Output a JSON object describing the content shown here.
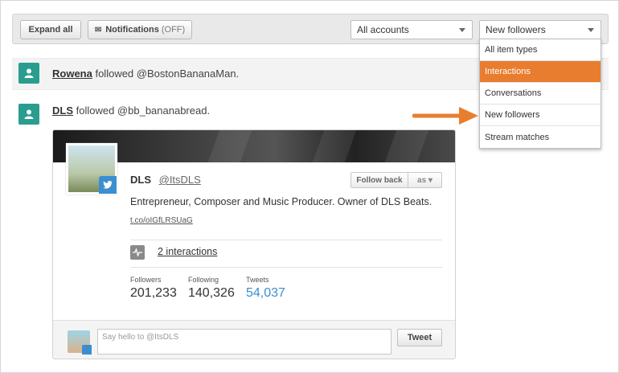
{
  "toolbar": {
    "expand_label": "Expand all",
    "notifications_label": "Notifications",
    "notifications_state": "(OFF)",
    "accounts_select": "All accounts",
    "type_select": "New followers"
  },
  "menu": {
    "items": [
      "All item types",
      "Interactions",
      "Conversations",
      "New followers",
      "Stream matches"
    ],
    "highlighted": "Interactions"
  },
  "stream": [
    {
      "user": "Rowena",
      "action": "followed @BostonBananaMan."
    },
    {
      "user": "DLS",
      "action": "followed @bb_bananabread."
    }
  ],
  "profile": {
    "name": "DLS",
    "handle": "@ItsDLS",
    "follow_back": "Follow back",
    "as_label": "as ▾",
    "bio": "Entrepreneur, Composer and Music Producer. Owner of DLS Beats.",
    "link": "t.co/oIGfLRSUaG",
    "interactions": "2 interactions",
    "stats": [
      {
        "label": "Followers",
        "value": "201,233"
      },
      {
        "label": "Following",
        "value": "140,326"
      },
      {
        "label": "Tweets",
        "value": "54,037"
      }
    ]
  },
  "reply": {
    "placeholder": "Say hello to @ItsDLS",
    "tweet_label": "Tweet"
  },
  "colors": {
    "accent": "#e97d2f",
    "user_icon": "#2a9d8f",
    "link_blue": "#3b8ed0"
  }
}
